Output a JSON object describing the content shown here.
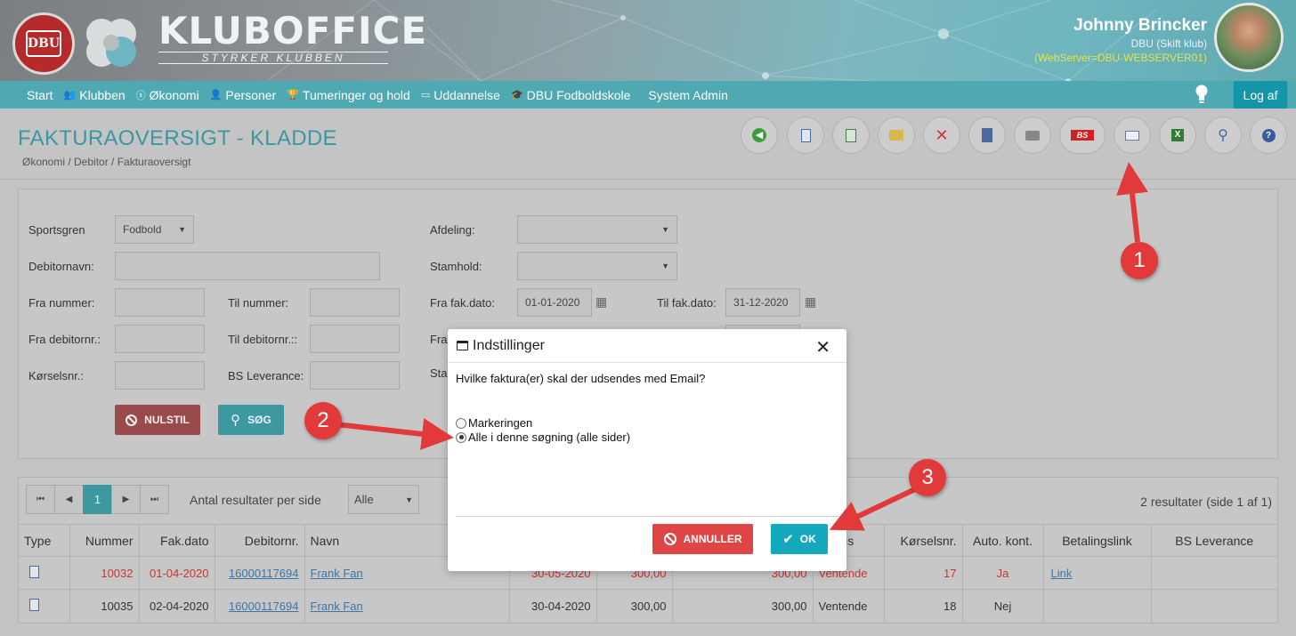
{
  "brand": {
    "name": "KLUBOFFICE",
    "tagline": "STYRKER KLUBBEN",
    "badge_text": "DBU"
  },
  "user": {
    "name": "Johnny Brincker",
    "club": "DBU (Skift klub)",
    "server": "(WebServer=DBU-WEBSERVER01)"
  },
  "nav": {
    "items": [
      {
        "label": "Start",
        "icon": ""
      },
      {
        "label": "Klubben",
        "icon": "people-icon"
      },
      {
        "label": "Økonomi",
        "icon": "coin-icon"
      },
      {
        "label": "Personer",
        "icon": "person-icon"
      },
      {
        "label": "Tumeringer og hold",
        "icon": "trophy-icon"
      },
      {
        "label": "Uddannelse",
        "icon": "presentation-icon"
      },
      {
        "label": "DBU Fodboldskole",
        "icon": "graduation-cap-icon"
      },
      {
        "label": "System Admin",
        "icon": ""
      }
    ],
    "logout": "Log af"
  },
  "page": {
    "title": "FAKTURAOVERSIGT - KLADDE",
    "breadcrumb": "Økonomi / Debitor / Fakturaoversigt"
  },
  "toolbar": [
    "back-icon",
    "new-invoice-icon",
    "copy-icon",
    "open-folder-icon",
    "delete-icon",
    "book-icon",
    "print-icon",
    "bs-icon",
    "email-icon",
    "excel-icon",
    "search-icon",
    "help-icon"
  ],
  "filter": {
    "sportsgren_label": "Sportsgren",
    "sportsgren_value": "Fodbold",
    "afdeling_label": "Afdeling:",
    "debitornavn_label": "Debitornavn:",
    "stamhold_label": "Stamhold:",
    "fra_nummer_label": "Fra nummer:",
    "til_nummer_label": "Til nummer:",
    "fra_fakdato_label": "Fra fak.dato:",
    "fra_fakdato_value": "01-01-2020",
    "til_fakdato_label": "Til fak.dato:",
    "til_fakdato_value": "31-12-2020",
    "fra_debitornr_label": "Fra debitornr.:",
    "til_debitornr_label": "Til debitornr.::",
    "fra_partial": "Fra",
    "korselsnr_label": "Kørselsnr.:",
    "bs_leverance_label": "BS Leverance:",
    "sta_partial": "Sta",
    "reset_label": "NULSTIL",
    "search_label": "SØG"
  },
  "results": {
    "page": "1",
    "per_page_label": "Antal resultater per side",
    "per_page_value": "Alle",
    "count": "2 resultater (side 1 af 1)",
    "columns": [
      "Type",
      "Nummer",
      "Fak.dato",
      "Debitornr.",
      "Navn",
      "",
      "",
      "",
      "Status",
      "Kørselsnr.",
      "Auto. kont.",
      "Betalingslink",
      "BS Leverance"
    ],
    "rows": [
      {
        "nummer": "10032",
        "fakdato": "01-04-2020",
        "debitornr": "16000117694",
        "navn": "Frank Fan",
        "forfald": "30-05-2020",
        "beloeb": "300,00",
        "total": "300,00",
        "status": "Ventende",
        "korselsnr": "17",
        "auto": "Ja",
        "link": "Link",
        "bs": ""
      },
      {
        "nummer": "10035",
        "fakdato": "02-04-2020",
        "debitornr": "16000117694",
        "navn": "Frank Fan",
        "forfald": "30-04-2020",
        "beloeb": "300,00",
        "total": "300,00",
        "status": "Ventende",
        "korselsnr": "18",
        "auto": "Nej",
        "link": "",
        "bs": ""
      }
    ]
  },
  "modal": {
    "title": "Indstillinger",
    "question": "Hvilke faktura(er) skal der udsendes med Email?",
    "option1": "Markeringen",
    "option2": "Alle i denne søgning (alle sider)",
    "selected": 2,
    "cancel_label": "ANNULLER",
    "ok_label": "OK"
  },
  "annotations": {
    "marker1": "1",
    "marker2": "2",
    "marker3": "3",
    "color": "#e23a3a"
  }
}
